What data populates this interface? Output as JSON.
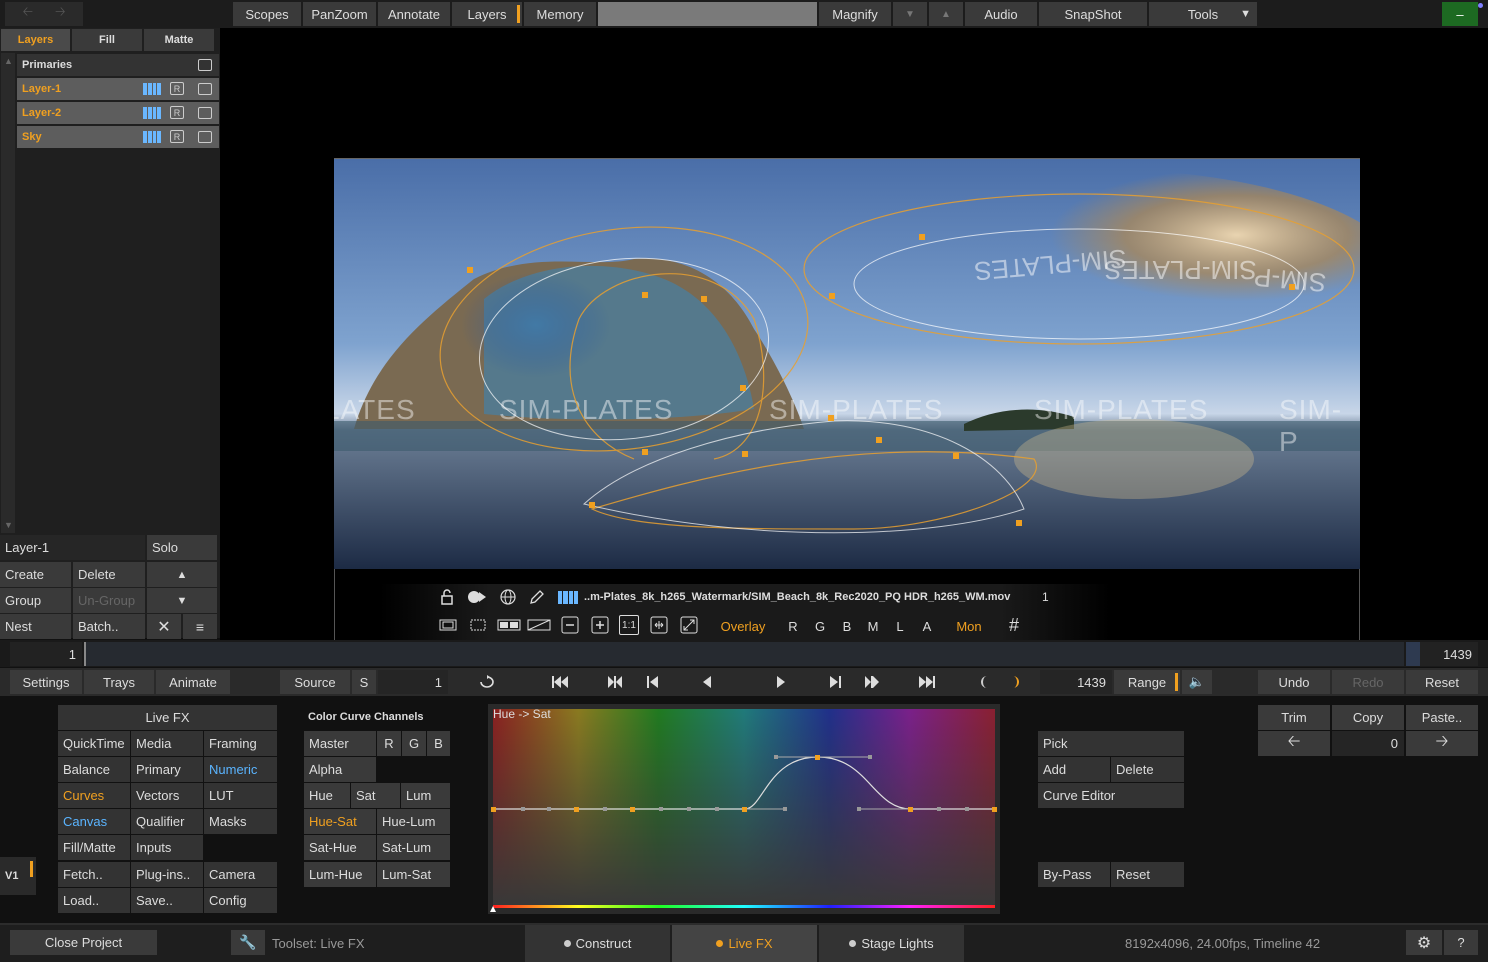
{
  "topbar": {
    "back_icon": "arrow-left-icon",
    "forward_icon": "arrow-right-icon",
    "items": [
      "Scopes",
      "PanZoom",
      "Annotate",
      "Layers",
      "Memory",
      "Magnify",
      "Audio",
      "SnapShot",
      "Tools"
    ],
    "minimize_label": "–"
  },
  "layers_panel": {
    "tabs": [
      "Layers",
      "Fill",
      "Matte"
    ],
    "group_label": "Primaries",
    "layers": [
      {
        "name": "Layer-1"
      },
      {
        "name": "Layer-2"
      },
      {
        "name": "Sky"
      }
    ],
    "current_layer": "Layer-1",
    "solo_label": "Solo",
    "create_label": "Create",
    "delete_label": "Delete",
    "group_btn_label": "Group",
    "ungroup_label": "Un-Group",
    "nest_label": "Nest",
    "batch_label": "Batch..",
    "r_label": "R"
  },
  "viewer": {
    "watermark_texts": [
      "SIM-PLATES",
      "SIM-PLATES",
      "SIM-PLATES",
      "SIM-P",
      "LATES",
      "SIM-PLATES",
      "SIM-PLATES",
      "SIM-P"
    ],
    "filename": "..m-Plates_8k_h265_Watermark/SIM_Beach_8k_Rec2020_PQ HDR_h265_WM.mov",
    "frame": "1",
    "overlay_label": "Overlay",
    "channels": [
      "R",
      "G",
      "B",
      "M",
      "L",
      "A"
    ],
    "mon_label": "Mon",
    "one_to_one": "1:1"
  },
  "timeline": {
    "start": "1",
    "end": "1439"
  },
  "transport": {
    "settings": "Settings",
    "trays": "Trays",
    "animate": "Animate",
    "source": "Source",
    "s_label": "S",
    "current_frame": "1",
    "end_frame": "1439",
    "range": "Range",
    "undo": "Undo",
    "redo": "Redo",
    "reset": "Reset"
  },
  "livefx": {
    "header": "Live FX",
    "grid": [
      [
        "QuickTime",
        "Media",
        "Framing"
      ],
      [
        "Balance",
        "Primary",
        "Numeric"
      ],
      [
        "Curves",
        "Vectors",
        "LUT"
      ],
      [
        "Canvas",
        "Qualifier",
        "Masks"
      ],
      [
        "Fill/Matte",
        "Inputs",
        ""
      ],
      [
        "Fetch..",
        "Plug-ins..",
        "Camera"
      ],
      [
        "Load..",
        "Save..",
        "Config"
      ]
    ],
    "v1_label": "V1"
  },
  "color_curve": {
    "header": "Color Curve Channels",
    "master": "Master",
    "r": "R",
    "g": "G",
    "b": "B",
    "alpha": "Alpha",
    "hue": "Hue",
    "sat": "Sat",
    "lum": "Lum",
    "hue_sat": "Hue-Sat",
    "hue_lum": "Hue-Lum",
    "sat_hue": "Sat-Hue",
    "sat_lum": "Sat-Lum",
    "lum_hue": "Lum-Hue",
    "lum_sat": "Lum-Sat"
  },
  "curve_graph": {
    "label": "Hue -> Sat"
  },
  "curve_tools": {
    "pick": "Pick",
    "add": "Add",
    "delete": "Delete",
    "curve_editor": "Curve Editor",
    "bypass": "By-Pass",
    "reset": "Reset"
  },
  "clipboard": {
    "trim": "Trim",
    "copy": "Copy",
    "paste": "Paste..",
    "value": "0"
  },
  "statusbar": {
    "close_project": "Close Project",
    "toolset": "Toolset: Live FX",
    "tabs": [
      "Construct",
      "Live FX",
      "Stage Lights"
    ],
    "info": "8192x4096, 24.00fps, Timeline 42",
    "help": "?"
  },
  "colors": {
    "accent": "#f0a020",
    "blue": "#5ab4ff",
    "panel": "#3a3a3a"
  }
}
